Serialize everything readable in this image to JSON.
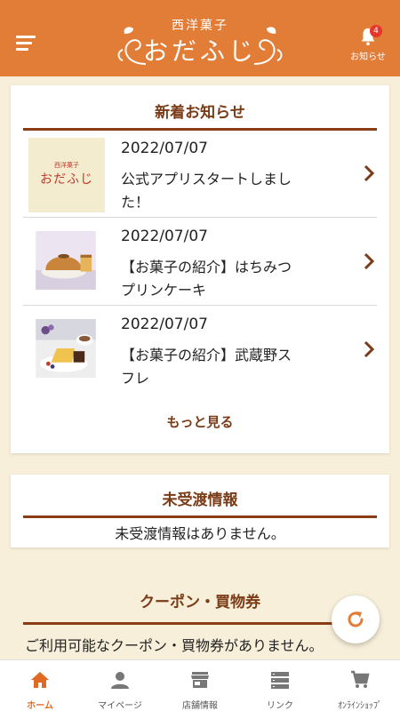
{
  "header": {
    "logo_subtitle": "西洋菓子",
    "logo_title": "おだふじ",
    "notice_label": "お知らせ",
    "notice_count": "4"
  },
  "news": {
    "title": "新着お知らせ",
    "items": [
      {
        "date": "2022/07/07",
        "title": "公式アプリスタートしました！",
        "thumb": "logo-thumbnail"
      },
      {
        "date": "2022/07/07",
        "title": "【お菓子の紹介】はちみつプリンケーキ",
        "thumb": "cake-photo"
      },
      {
        "date": "2022/07/07",
        "title": "【お菓子の紹介】武蔵野スフレ",
        "thumb": "souffle-photo"
      }
    ],
    "more_label": "もっと見る",
    "thumb_logo_sub": "西洋菓子",
    "thumb_logo_main": "おだふじ"
  },
  "unreceived": {
    "title": "未受渡情報",
    "message": "未受渡情報はありません。"
  },
  "coupon": {
    "title": "クーポン・買物券",
    "message": "ご利用可能なクーポン・買物券がありません。"
  },
  "tabs": [
    {
      "label": "ホーム",
      "icon": "home-icon",
      "active": true
    },
    {
      "label": "マイページ",
      "icon": "person-icon",
      "active": false
    },
    {
      "label": "店舗情報",
      "icon": "store-icon",
      "active": false
    },
    {
      "label": "リンク",
      "icon": "list-icon",
      "active": false
    },
    {
      "label": "ｵﾝﾗｲﾝｼｮｯﾌﾟ",
      "icon": "cart-icon",
      "active": false
    }
  ],
  "colors": {
    "header": "#e27d38",
    "background": "#f7efd9",
    "accent_brown": "#7a3b16",
    "tab_active": "#e06a23",
    "badge": "#e8352b"
  }
}
